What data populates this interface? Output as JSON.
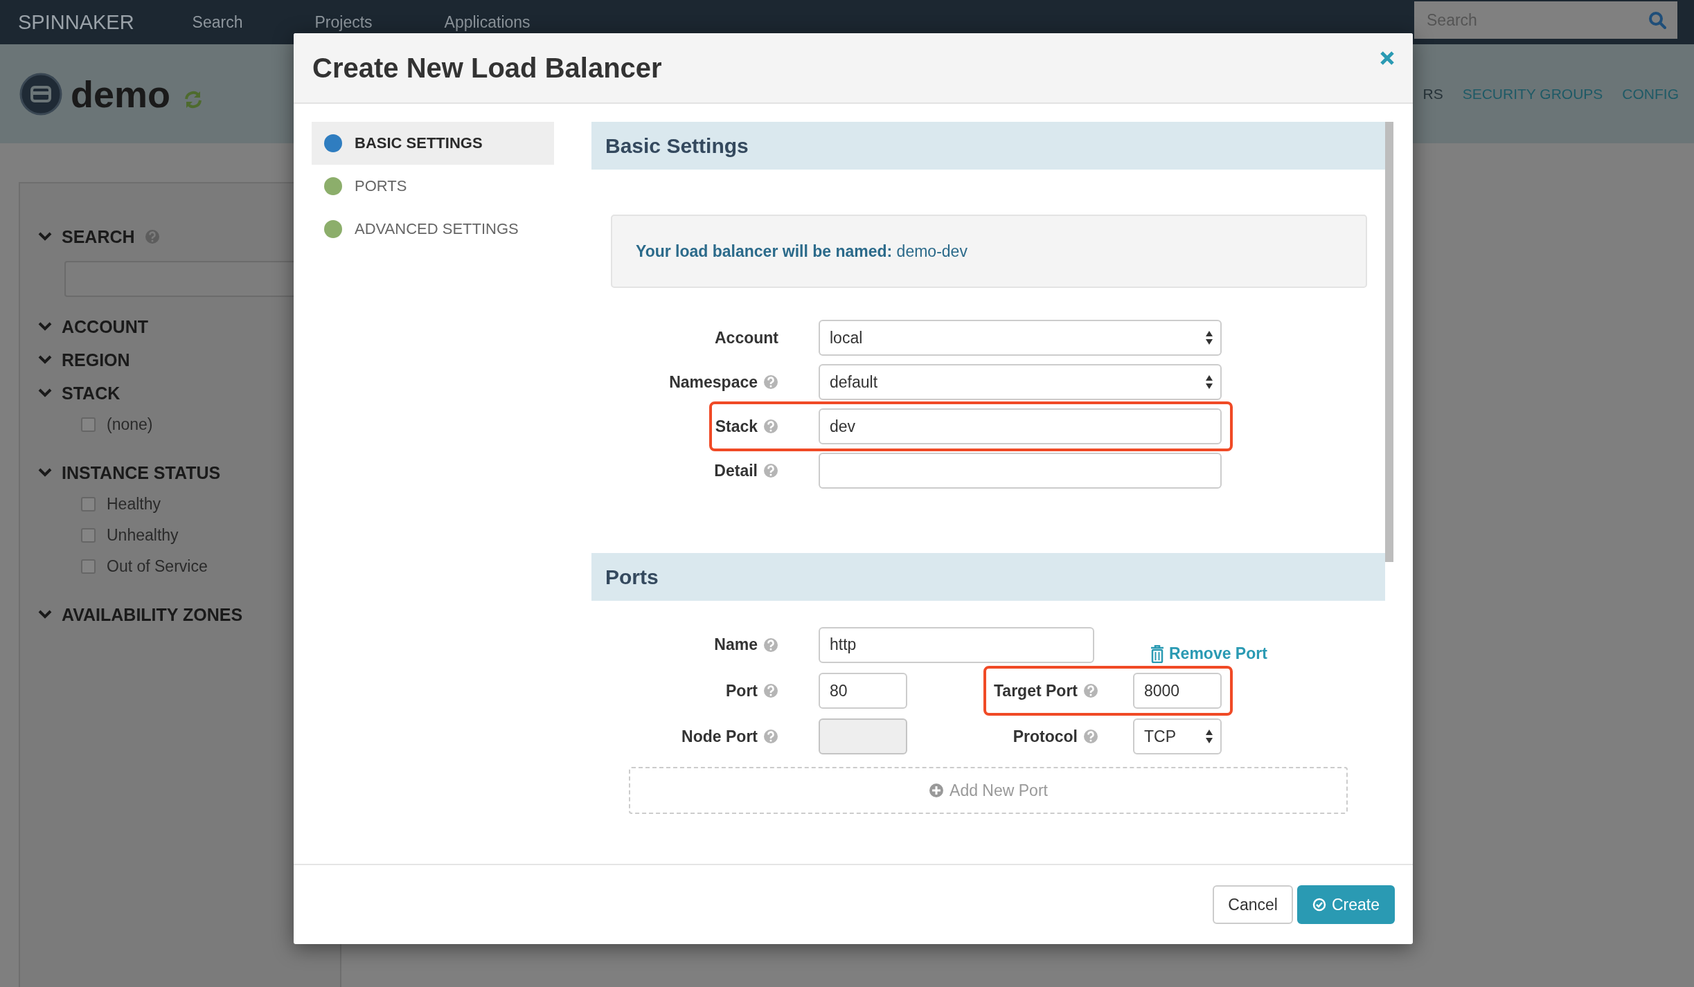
{
  "top_nav": {
    "logo": "SPINNAKER",
    "items": [
      "Search",
      "Projects",
      "Applications"
    ],
    "search": {
      "placeholder": "Search"
    }
  },
  "app_header": {
    "name": "demo",
    "tabs": [
      {
        "label": "RS",
        "selected": true
      },
      {
        "label": "SECURITY GROUPS",
        "selected": false
      },
      {
        "label": "CONFIG",
        "selected": false
      }
    ]
  },
  "filters": [
    {
      "title": "SEARCH",
      "kind": "search",
      "help": true,
      "expanded": true
    },
    {
      "title": "ACCOUNT",
      "kind": "list",
      "help": false,
      "expanded": true
    },
    {
      "title": "REGION",
      "kind": "list",
      "help": false,
      "expanded": true
    },
    {
      "title": "STACK",
      "kind": "list",
      "help": false,
      "expanded": true,
      "options": [
        {
          "label": "(none)",
          "checked": false
        }
      ]
    },
    {
      "title": "INSTANCE STATUS",
      "kind": "list",
      "help": false,
      "expanded": true,
      "options": [
        {
          "label": "Healthy",
          "checked": false
        },
        {
          "label": "Unhealthy",
          "checked": false
        },
        {
          "label": "Out of Service",
          "checked": false
        }
      ]
    },
    {
      "title": "AVAILABILITY ZONES",
      "kind": "list",
      "help": false,
      "expanded": true
    }
  ],
  "modal": {
    "title": "Create New Load Balancer",
    "steps": [
      {
        "label": "BASIC SETTINGS",
        "selected": true,
        "color": "#2f7dc0"
      },
      {
        "label": "PORTS",
        "selected": false,
        "color": "#8cae6b"
      },
      {
        "label": "ADVANCED SETTINGS",
        "selected": false,
        "color": "#8cae6b"
      }
    ],
    "basic_settings": {
      "title": "Basic Settings",
      "name_preview": "**Your load balancer will be named:** demo-dev",
      "fields": [
        {
          "label": "Account",
          "kind": "select",
          "value": "local",
          "help": false,
          "highlighted": false
        },
        {
          "label": "Namespace",
          "kind": "select",
          "value": "default",
          "help": true,
          "highlighted": false
        },
        {
          "label": "Stack",
          "kind": "input",
          "value": "dev",
          "help": true,
          "highlighted": true
        },
        {
          "label": "Detail",
          "kind": "input",
          "help": true,
          "highlighted": false
        }
      ]
    },
    "ports": {
      "title": "Ports",
      "rows": [
        [
          {
            "label": "Name",
            "kind": "input",
            "value": "http",
            "help": true,
            "highlighted": false
          },
          {
            "label": "Remove Port",
            "kind": "link"
          }
        ],
        [
          {
            "label": "Port",
            "kind": "input",
            "value": "80",
            "help": true,
            "highlighted": false
          },
          {
            "label": "Target Port",
            "kind": "input",
            "value": "8000",
            "help": true,
            "highlighted": true
          }
        ],
        [
          {
            "label": "Node Port",
            "kind": "input",
            "help": true,
            "highlighted": false,
            "disabled": true
          },
          {
            "label": "Protocol",
            "kind": "select",
            "value": "TCP",
            "help": true,
            "highlighted": false
          }
        ]
      ],
      "add_button": "Add New Port"
    },
    "buttons": [
      {
        "label": "Cancel",
        "kind": "default"
      },
      {
        "label": "Create",
        "kind": "primary"
      }
    ]
  }
}
